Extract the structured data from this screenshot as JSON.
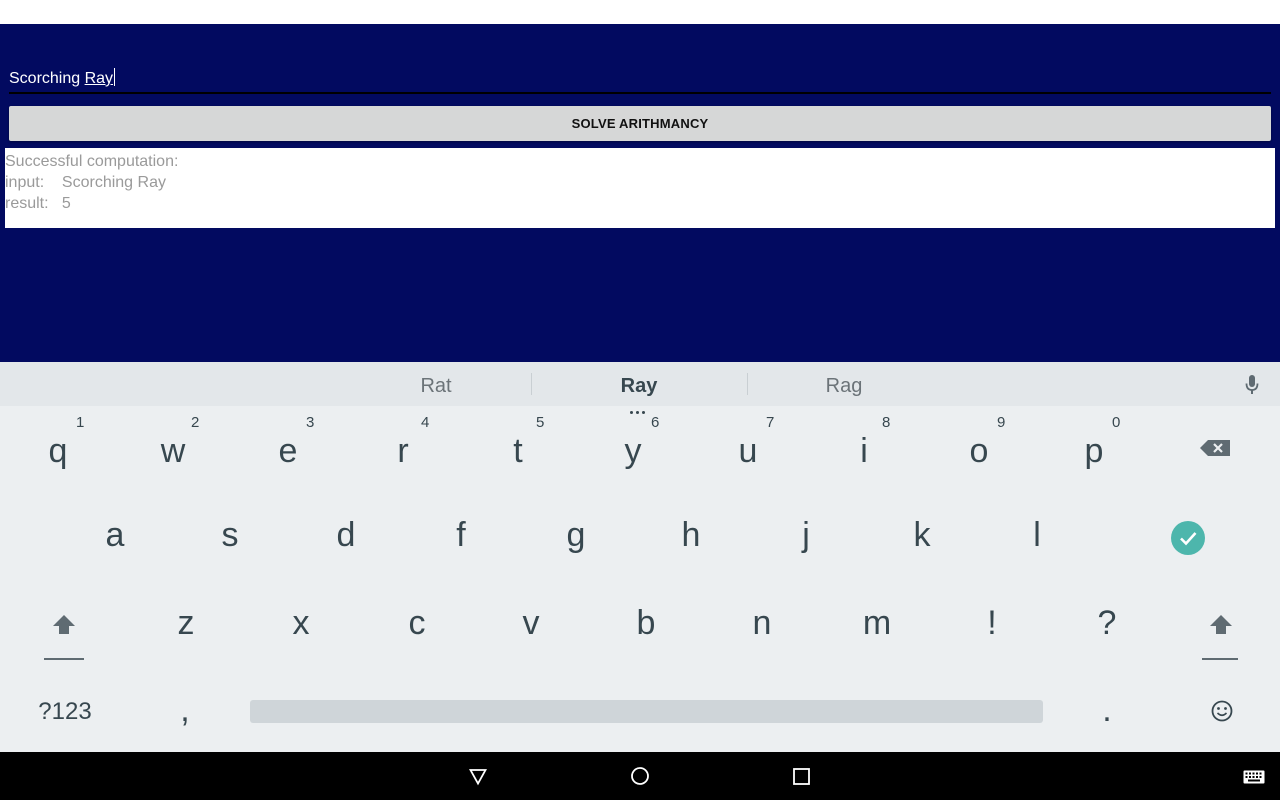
{
  "app": {
    "input_value": "Scorching ",
    "input_composing": "Ray",
    "solve_button_label": "SOLVE ARITHMANCY",
    "result_lines": [
      "Successful computation:",
      "input:    Scorching Ray",
      "result:   5"
    ]
  },
  "keyboard": {
    "suggestions": [
      "Rat",
      "Ray",
      "Rag"
    ],
    "row1": [
      {
        "key": "q",
        "hint": "1"
      },
      {
        "key": "w",
        "hint": "2"
      },
      {
        "key": "e",
        "hint": "3"
      },
      {
        "key": "r",
        "hint": "4"
      },
      {
        "key": "t",
        "hint": "5"
      },
      {
        "key": "y",
        "hint": "6"
      },
      {
        "key": "u",
        "hint": "7"
      },
      {
        "key": "i",
        "hint": "8"
      },
      {
        "key": "o",
        "hint": "9"
      },
      {
        "key": "p",
        "hint": "0"
      }
    ],
    "row2": [
      "a",
      "s",
      "d",
      "f",
      "g",
      "h",
      "j",
      "k",
      "l"
    ],
    "row3": [
      "z",
      "x",
      "c",
      "v",
      "b",
      "n",
      "m",
      "!",
      "?"
    ],
    "symbols_label": "?123",
    "comma": ",",
    "period": ".",
    "icons": {
      "backspace": "backspace-icon",
      "done": "checkmark-icon",
      "shift": "shift-icon",
      "emoji": "emoji-icon",
      "mic": "microphone-icon"
    },
    "accent_color": "#4db6ac"
  },
  "navbar": {
    "icons": [
      "back-icon",
      "home-icon",
      "recents-icon",
      "keyboard-switch-icon"
    ]
  },
  "colors": {
    "app_background": "#020a60",
    "button_background": "#d6d7d7",
    "keyboard_background": "#eceff1"
  }
}
